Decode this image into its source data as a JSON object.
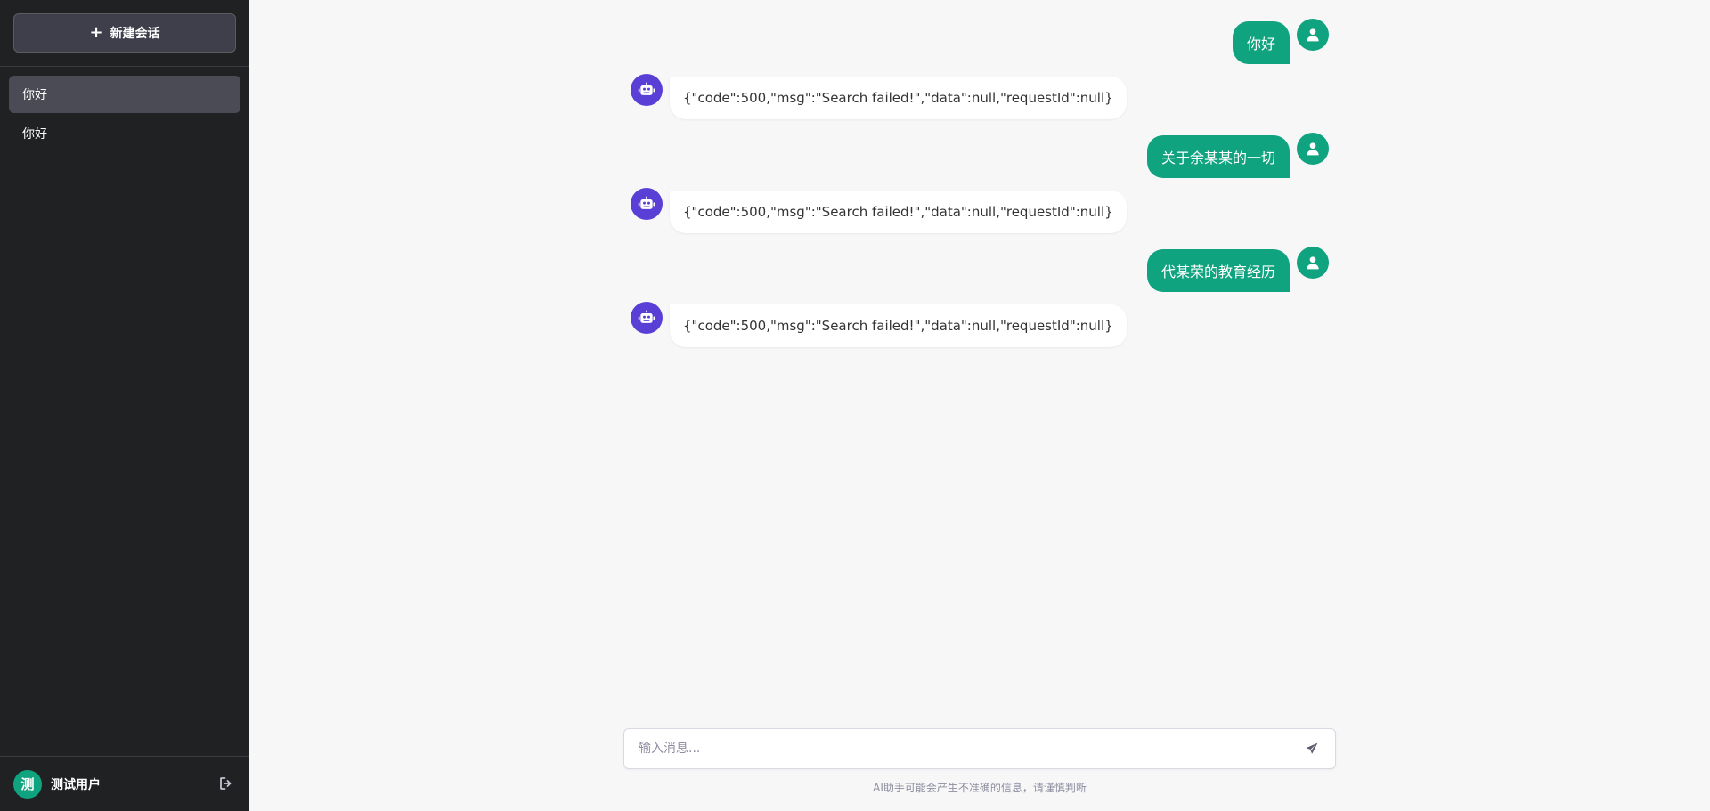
{
  "sidebar": {
    "new_chat_label": "新建会话",
    "conversations": [
      {
        "title": "你好",
        "active": true
      },
      {
        "title": "你好",
        "active": false
      }
    ],
    "user": {
      "avatar_char": "测",
      "name": "测试用户"
    }
  },
  "messages": [
    {
      "role": "user",
      "text": "你好"
    },
    {
      "role": "bot",
      "text": "{\"code\":500,\"msg\":\"Search failed!\",\"data\":null,\"requestId\":null}"
    },
    {
      "role": "user",
      "text": "关于余某某的一切"
    },
    {
      "role": "bot",
      "text": "{\"code\":500,\"msg\":\"Search failed!\",\"data\":null,\"requestId\":null}"
    },
    {
      "role": "user",
      "text": "代某荣的教育经历"
    },
    {
      "role": "bot",
      "text": "{\"code\":500,\"msg\":\"Search failed!\",\"data\":null,\"requestId\":null}"
    }
  ],
  "composer": {
    "value": "",
    "placeholder": "输入消息..."
  },
  "disclaimer": "AI助手可能会产生不准确的信息，请谨慎判断",
  "colors": {
    "accent": "#10a37f",
    "bot_avatar": "#5a3fd6",
    "sidebar_bg": "#202123"
  }
}
